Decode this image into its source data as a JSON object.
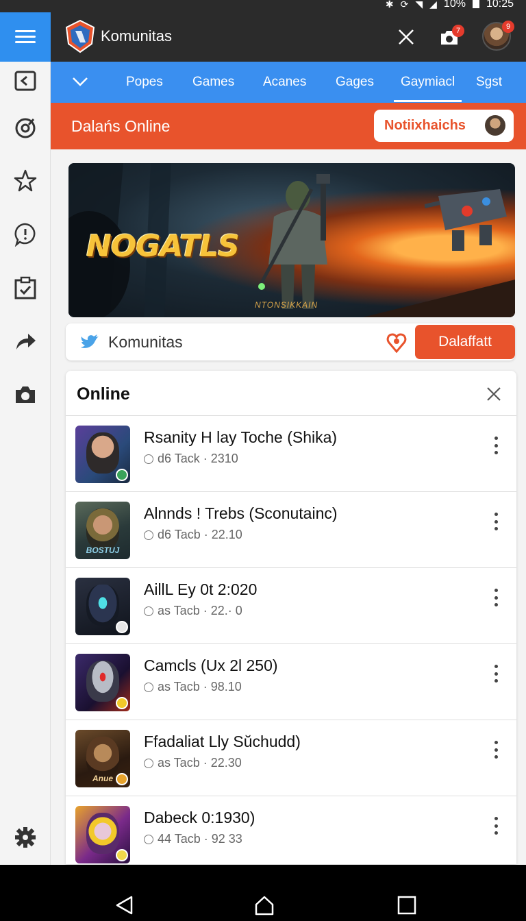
{
  "status_bar": {
    "battery": "10%",
    "time": "10:25"
  },
  "rail": {
    "items": [
      {
        "icon": "back-square-icon"
      },
      {
        "icon": "compass-icon"
      },
      {
        "icon": "star-icon"
      },
      {
        "icon": "alert-icon"
      },
      {
        "icon": "clipboard-check-icon"
      },
      {
        "icon": "share-icon"
      },
      {
        "icon": "camera-icon"
      }
    ],
    "settings_icon": "gear-icon"
  },
  "app_bar": {
    "title": "Komunitas",
    "camera_badge": "7",
    "avatar_badge": "9"
  },
  "tabs": [
    {
      "label": "Popes"
    },
    {
      "label": "Games"
    },
    {
      "label": "Acanes"
    },
    {
      "label": "Gages"
    },
    {
      "label": "Gaymiacl"
    },
    {
      "label": "Sgst"
    }
  ],
  "section": {
    "title": "Dalańs Online",
    "notification_button": "Notiixhaichs"
  },
  "banner": {
    "wordmark": "NOGATLS",
    "caption": "NTONSIKKAIN"
  },
  "community_bar": {
    "label": "Komunitas",
    "button": "Dalaffatt"
  },
  "online": {
    "title": "Online",
    "rows": [
      {
        "name": "Rsanity H lay Toche (Shika)",
        "meta": "d6 Tack · 2310",
        "thumb_text": ""
      },
      {
        "name": "Alnnds ! Trebs (Sconutainc)",
        "meta": "d6 Tacb · 22.10",
        "thumb_text": "BOSTUJ"
      },
      {
        "name": "AillL Ey 0t 2:020",
        "meta": "as Tacb · 22.· 0",
        "thumb_text": ""
      },
      {
        "name": "Camcls (Ux 2l 250)",
        "meta": "as Tacb · 98.10",
        "thumb_text": ""
      },
      {
        "name": "Ffadaliat Lly Sŭchudd)",
        "meta": "as Tacb · 22.30",
        "thumb_text": "Anue"
      },
      {
        "name": "Dabeck 0:1930)",
        "meta": "44 Tacb · 92 33",
        "thumb_text": ""
      }
    ]
  },
  "colors": {
    "accent_blue": "#3a8ff0",
    "accent_orange": "#e8532c",
    "appbar": "#2b2b2b"
  }
}
